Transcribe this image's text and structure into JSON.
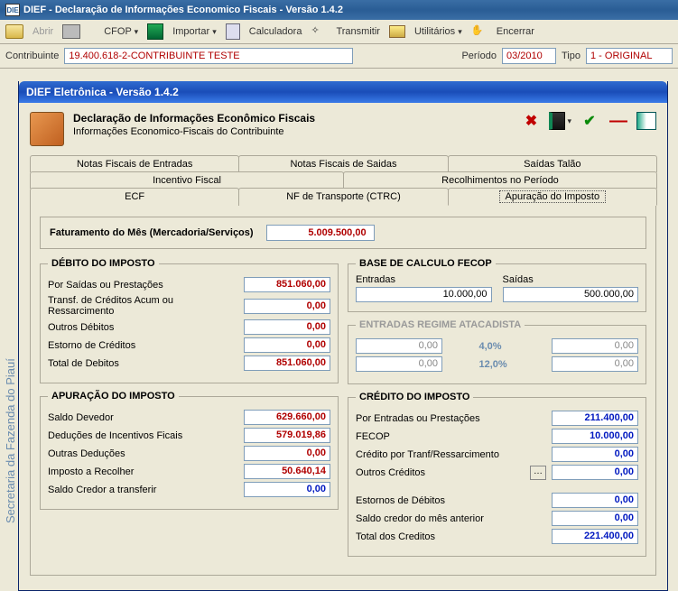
{
  "titlebar": {
    "icon_text": "DIE",
    "title": "DIEF - Declaração de Informações Economico Fiscais - Versão 1.4.2"
  },
  "toolbar": {
    "abrir": "Abrir",
    "cfop": "CFOP",
    "importar": "Importar",
    "calculadora": "Calculadora",
    "transmitir": "Transmitir",
    "utilitarios": "Utilitários",
    "encerrar": "Encerrar"
  },
  "headerfields": {
    "contrib_label": "Contribuinte",
    "contrib_value": "19.400.618-2-CONTRIBUINTE TESTE",
    "periodo_label": "Período",
    "periodo_value": "03/2010",
    "tipo_label": "Tipo",
    "tipo_value": "1 - ORIGINAL"
  },
  "sidetext": "Secretaria da Fazenda do Piauí",
  "dialog": {
    "title": "DIEF Eletrônica - Versão 1.4.2",
    "header_title": "Declaração de Informações Econômico Fiscais",
    "header_sub": "Informações Economico-Fiscais do Contribuinte"
  },
  "tabs": {
    "row1": [
      "Notas Fiscais de Entradas",
      "Notas Fiscais de Saidas",
      "Saídas Talão"
    ],
    "row2": [
      "Incentivo Fiscal",
      "Recolhimentos no Período"
    ],
    "row3": [
      "ECF",
      "NF de Transporte (CTRC)",
      "Apuração do Imposto"
    ]
  },
  "faturamento": {
    "label": "Faturamento do Mês (Mercadoria/Serviços)",
    "value": "5.009.500,00"
  },
  "debito": {
    "title": "DÉBITO DO IMPOSTO",
    "por_saidas_lbl": "Por Saídas ou Prestações",
    "por_saidas": "851.060,00",
    "transf_lbl": "Transf. de Créditos Acum ou Ressarcimento",
    "transf": "0,00",
    "outros_lbl": "Outros Débitos",
    "outros": "0,00",
    "estorno_lbl": "Estorno de Créditos",
    "estorno": "0,00",
    "total_lbl": "Total de Debitos",
    "total": "851.060,00"
  },
  "apuracao": {
    "title": "APURAÇÃO DO IMPOSTO",
    "saldo_dev_lbl": "Saldo Devedor",
    "saldo_dev": "629.660,00",
    "deducoes_lbl": "Deduções de Incentivos Ficais",
    "deducoes": "579.019,86",
    "outras_lbl": "Outras Deduções",
    "outras": "0,00",
    "recolher_lbl": "Imposto a Recolher",
    "recolher": "50.640,14",
    "credor_lbl": "Saldo Credor a transferir",
    "credor": "0,00"
  },
  "fecop": {
    "title": "BASE DE CALCULO FECOP",
    "entradas_lbl": "Entradas",
    "entradas": "10.000,00",
    "saidas_lbl": "Saídas",
    "saidas": "500.000,00"
  },
  "atac": {
    "title": "ENTRADAS REGIME ATACADISTA",
    "pct1": "4,0%",
    "v1a": "0,00",
    "v1b": "0,00",
    "pct2": "12,0%",
    "v2a": "0,00",
    "v2b": "0,00"
  },
  "credito": {
    "title": "CRÉDITO DO IMPOSTO",
    "por_ent_lbl": "Por Entradas ou Prestações",
    "por_ent": "211.400,00",
    "fecop_lbl": "FECOP",
    "fecop": "10.000,00",
    "tranf_lbl": "Crédito por Tranf/Ressarcimento",
    "tranf": "0,00",
    "outros_lbl": "Outros Créditos",
    "outros": "0,00",
    "estornos_lbl": "Estornos de Débitos",
    "estornos": "0,00",
    "saldo_ant_lbl": "Saldo credor do mês anterior",
    "saldo_ant": "0,00",
    "total_lbl": "Total dos Creditos",
    "total": "221.400,00"
  }
}
